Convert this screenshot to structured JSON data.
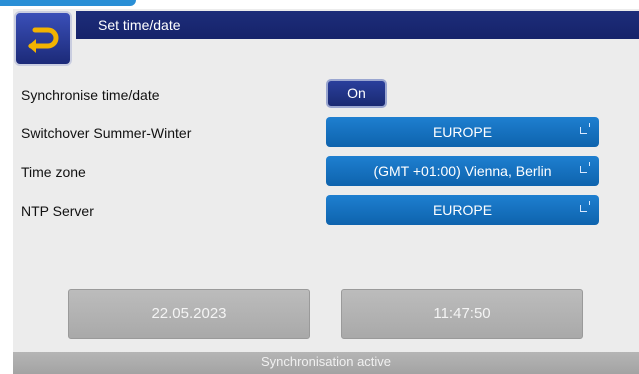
{
  "header": {
    "title": "Set time/date",
    "back_icon": "back-arrow-icon"
  },
  "settings": {
    "sync": {
      "label": "Synchronise time/date",
      "toggle": "On"
    },
    "switchover": {
      "label": "Switchover Summer-Winter",
      "value": "EUROPE"
    },
    "timezone": {
      "label": "Time zone",
      "value": "(GMT +01:00) Vienna, Berlin"
    },
    "ntp": {
      "label": "NTP Server",
      "value": "EUROPE"
    }
  },
  "datetime": {
    "date": "22.05.2023",
    "time": "11:47:50"
  },
  "status": "Synchronisation active",
  "colors": {
    "title_bar": "#16236a",
    "select_blue": "#1470c0",
    "panel": "#ececec",
    "accent": "#2a8fd6"
  }
}
